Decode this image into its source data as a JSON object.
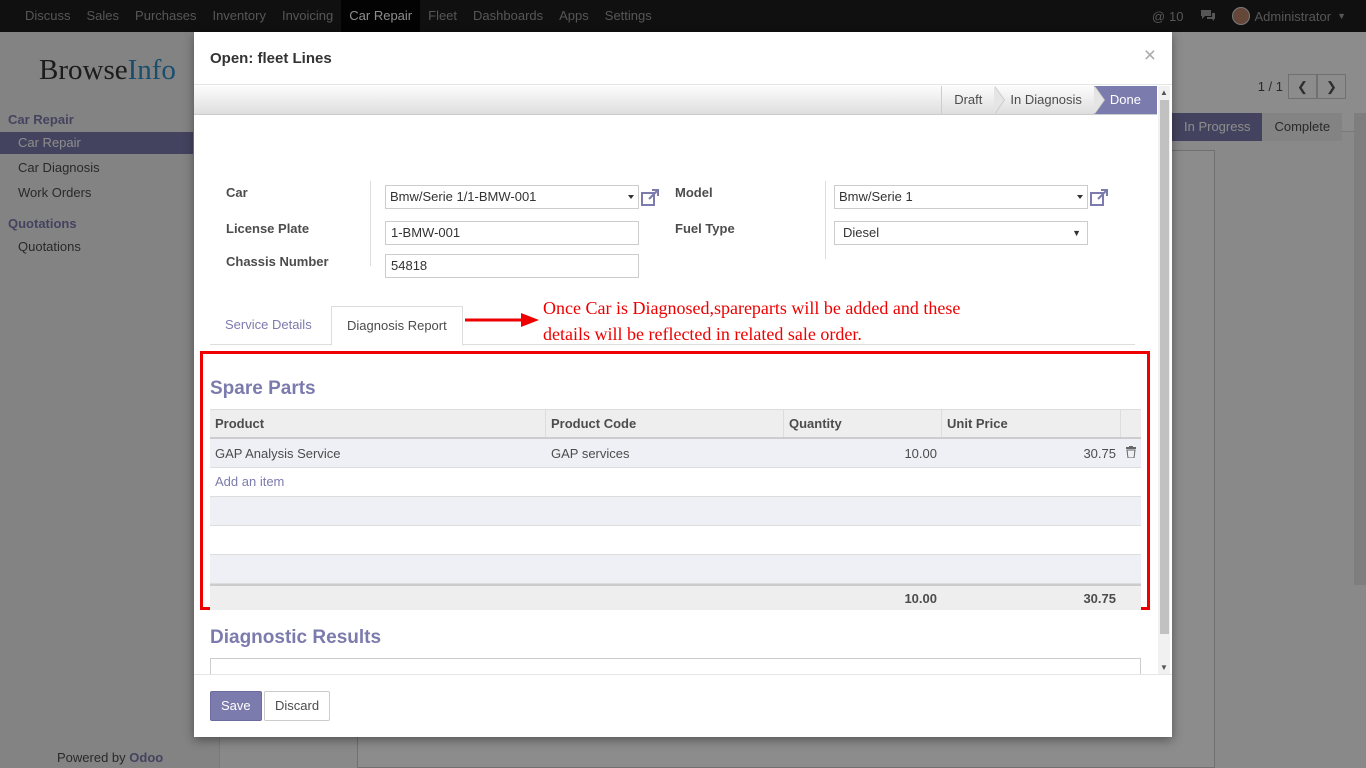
{
  "topbar": {
    "menu": [
      "Discuss",
      "Sales",
      "Purchases",
      "Inventory",
      "Invoicing",
      "Car Repair",
      "Fleet",
      "Dashboards",
      "Apps",
      "Settings"
    ],
    "active_menu": "Car Repair",
    "mentions_count": "10",
    "user": "Administrator"
  },
  "sidebar": {
    "logo_a": "Browse",
    "logo_b": "Info",
    "sections": [
      {
        "title": "Car Repair",
        "items": [
          "Car Repair",
          "Car Diagnosis",
          "Work Orders"
        ]
      },
      {
        "title": "Quotations",
        "items": [
          "Quotations"
        ]
      }
    ],
    "selected": "Car Repair",
    "powered_prefix": "Powered by ",
    "powered_brand": "Odoo"
  },
  "background": {
    "pager": "1 / 1",
    "status": {
      "in_progress": "In Progress",
      "complete": "Complete"
    }
  },
  "modal": {
    "title": "Open: fleet Lines",
    "close": "×",
    "stages": [
      "Draft",
      "In Diagnosis",
      "Done"
    ],
    "active_stage": "Done",
    "fields": {
      "car_label": "Car",
      "car_value": "Bmw/Serie 1/1-BMW-001",
      "license_label": "License Plate",
      "license_value": "1-BMW-001",
      "chassis_label": "Chassis Number",
      "chassis_value": "54818",
      "model_label": "Model",
      "model_value": "Bmw/Serie 1",
      "fuel_label": "Fuel Type",
      "fuel_value": "Diesel"
    },
    "tabs": [
      "Service Details",
      "Diagnosis Report"
    ],
    "active_tab": "Diagnosis Report",
    "annotation_line1": "Once Car is Diagnosed,spareparts will be added and these",
    "annotation_line2": "details will be reflected in related sale order.",
    "spare_parts": {
      "title": "Spare Parts",
      "columns": [
        "Product",
        "Product Code",
        "Quantity",
        "Unit Price"
      ],
      "rows": [
        {
          "product": "GAP Analysis Service",
          "code": "GAP services",
          "quantity": "10.00",
          "unit_price": "30.75"
        }
      ],
      "add_item": "Add an item",
      "total_quantity": "10.00",
      "total_price": "30.75"
    },
    "diagnostic_title": "Diagnostic Results",
    "save": "Save",
    "discard": "Discard"
  },
  "colors": {
    "accent": "#7c7bad",
    "annotation": "#ee0000",
    "topbar": "#1e1e1e"
  }
}
